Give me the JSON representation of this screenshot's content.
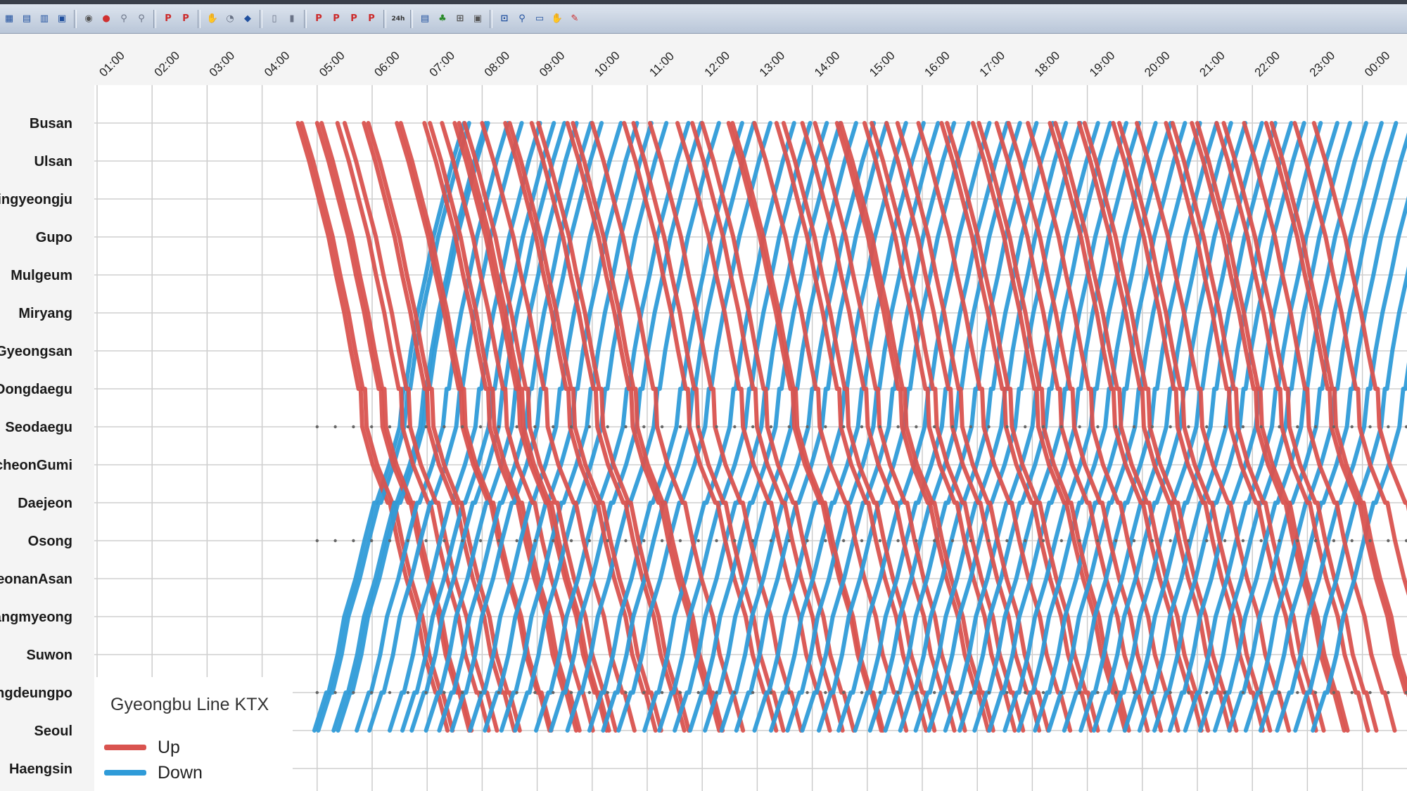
{
  "toolbar": {
    "buttons": [
      {
        "glyph": "▦",
        "color": "#1f4f9e"
      },
      {
        "glyph": "▤",
        "color": "#1f4f9e"
      },
      {
        "glyph": "▥",
        "color": "#1f4f9e"
      },
      {
        "glyph": "▣",
        "color": "#1f4f9e"
      },
      {
        "sep": true
      },
      {
        "glyph": "◉",
        "color": "#555555"
      },
      {
        "glyph": "●",
        "color": "#d03030"
      },
      {
        "glyph": "⚲",
        "color": "#6a7386"
      },
      {
        "glyph": "⚲",
        "color": "#6a7386"
      },
      {
        "sep": true
      },
      {
        "glyph": "P",
        "color": "#cc2a2a"
      },
      {
        "glyph": "P",
        "color": "#cc2a2a"
      },
      {
        "sep": true
      },
      {
        "glyph": "✋",
        "color": "#6a7386"
      },
      {
        "glyph": "◔",
        "color": "#6a7386"
      },
      {
        "glyph": "◆",
        "color": "#1f4f9e"
      },
      {
        "sep": true
      },
      {
        "glyph": "▯",
        "color": "#6a7386"
      },
      {
        "glyph": "▮",
        "color": "#6a7386"
      },
      {
        "sep": true
      },
      {
        "glyph": "P",
        "color": "#cc2a2a"
      },
      {
        "glyph": "P",
        "color": "#cc2a2a"
      },
      {
        "glyph": "P",
        "color": "#cc2a2a"
      },
      {
        "glyph": "P",
        "color": "#cc2a2a"
      },
      {
        "sep": true
      },
      {
        "glyph": "24h",
        "color": "#333333"
      },
      {
        "sep": true
      },
      {
        "glyph": "▤",
        "color": "#1f4f9e"
      },
      {
        "glyph": "♣",
        "color": "#2a8a2a"
      },
      {
        "glyph": "⊞",
        "color": "#555555"
      },
      {
        "glyph": "▣",
        "color": "#555555"
      },
      {
        "sep": true
      },
      {
        "glyph": "⊡",
        "color": "#1f4f9e"
      },
      {
        "glyph": "⚲",
        "color": "#1f4f9e"
      },
      {
        "glyph": "▭",
        "color": "#1f4f9e"
      },
      {
        "glyph": "✋",
        "color": "#555555"
      },
      {
        "glyph": "✎",
        "color": "#cc2a2a"
      }
    ]
  },
  "chart_data": {
    "type": "line",
    "title": "",
    "xlabel": "",
    "ylabel": "",
    "x_ticks": [
      "01:00",
      "02:00",
      "03:00",
      "04:00",
      "05:00",
      "06:00",
      "07:00",
      "08:00",
      "09:00",
      "10:00",
      "11:00",
      "12:00",
      "13:00",
      "14:00",
      "15:00",
      "16:00",
      "17:00",
      "18:00",
      "19:00",
      "20:00",
      "21:00",
      "22:00",
      "23:00",
      "00:00",
      "01:00"
    ],
    "x_range_hours": [
      1.0,
      26.3
    ],
    "stations": [
      "Busan",
      "Ulsan",
      "Singyeongju",
      "Gupo",
      "Mulgeum",
      "Miryang",
      "Gyeongsan",
      "Dongdaegu",
      "Seodaegu",
      "GimcheonGumi",
      "Daejeon",
      "Osong",
      "CheonanAsan",
      "Gwangmyeong",
      "Suwon",
      "Yeongdeungpo",
      "Seoul",
      "Haengsin"
    ],
    "station_axis_labels": [
      "Busan",
      "Ulsan",
      "ingyeongju",
      "Gupo",
      "Mulgeum",
      "Miryang",
      "Gyeongsan",
      "Dongdaegu",
      "Seodaegu",
      "cheonGumi",
      "Daejeon",
      "Osong",
      "eonanAsan",
      "angmyeong",
      "Suwon",
      "ngdeungpo",
      "Seoul",
      "Haengsin"
    ],
    "grid": true,
    "legend": {
      "title": "Gyeongbu Line KTX",
      "placement": "bottom-left",
      "entries": [
        {
          "label": "Up",
          "color": "#d9534f"
        },
        {
          "label": "Down",
          "color": "#2f9bd8"
        }
      ]
    },
    "series": [
      {
        "name": "Up",
        "color": "#d9534f",
        "direction": "Busan to Seoul",
        "route": [
          0,
          1,
          2,
          3,
          4,
          5,
          6,
          7,
          8,
          9,
          10,
          11,
          12,
          13,
          14,
          15,
          16
        ],
        "starts": [
          4.65,
          4.72,
          5.0,
          5.08,
          5.37,
          5.5,
          5.85,
          5.93,
          6.45,
          6.52,
          6.95,
          7.05,
          7.27,
          7.5,
          7.58,
          7.68,
          8.0,
          8.42,
          8.5,
          8.9,
          9.02,
          9.55,
          9.65,
          10.0,
          10.58,
          10.75,
          11.05,
          11.55,
          11.82,
          12.0,
          12.48,
          12.55,
          12.95,
          13.35,
          13.48,
          13.82,
          14.05,
          14.45,
          14.52,
          14.95,
          15.08,
          15.35,
          15.55,
          15.93,
          16.35,
          16.45,
          16.92,
          17.03,
          17.35,
          17.57,
          17.92,
          18.32,
          18.42,
          18.85,
          18.95,
          19.47,
          19.58,
          19.9,
          20.43,
          20.55,
          20.9,
          21.0,
          21.35,
          21.48,
          21.85,
          22.25,
          22.35,
          22.77,
          23.12
        ],
        "total_duration_hours": 2.75
      },
      {
        "name": "Down",
        "color": "#2f9bd8",
        "direction": "Seoul to Busan",
        "route": [
          16,
          15,
          14,
          13,
          12,
          11,
          10,
          9,
          8,
          7,
          6,
          5,
          4,
          3,
          2,
          1,
          0
        ],
        "starts": [
          4.95,
          5.02,
          5.3,
          5.38,
          5.72,
          5.95,
          6.32,
          6.55,
          6.72,
          6.98,
          7.22,
          7.45,
          7.78,
          8.05,
          8.35,
          8.6,
          8.98,
          9.25,
          9.55,
          9.95,
          10.2,
          10.48,
          10.95,
          11.22,
          11.5,
          11.78,
          12.05,
          12.35,
          12.62,
          12.95,
          13.25,
          13.55,
          13.82,
          14.12,
          14.48,
          14.78,
          15.05,
          15.33,
          15.6,
          15.88,
          16.12,
          16.42,
          16.68,
          16.95,
          17.22,
          17.5,
          17.75,
          18.05,
          18.3,
          18.58,
          18.88,
          19.12,
          19.4,
          19.68,
          19.95,
          20.22,
          20.5,
          20.78,
          21.05,
          21.32,
          21.58,
          21.88,
          22.15,
          22.45,
          22.78,
          23.1
        ],
        "total_duration_hours": 2.75
      }
    ]
  }
}
